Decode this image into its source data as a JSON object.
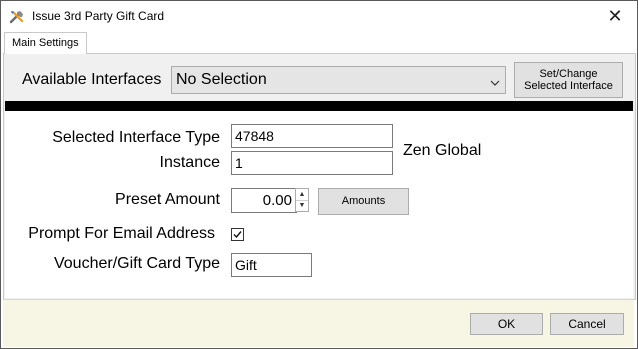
{
  "window": {
    "title": "Issue 3rd Party Gift Card"
  },
  "tabs": [
    {
      "label": "Main Settings"
    }
  ],
  "interfaces": {
    "label": "Available Interfaces",
    "selected": "No Selection",
    "set_button": "Set/Change Selected Interface"
  },
  "form": {
    "selected_interface_type_label": "Selected Interface Type",
    "selected_interface_type_value": "47848",
    "instance_label": "Instance",
    "instance_value": "1",
    "interface_name": "Zen Global",
    "preset_amount_label": "Preset Amount",
    "preset_amount_value": "0.00",
    "amounts_button": "Amounts",
    "prompt_email_label": "Prompt For Email Address",
    "prompt_email_checked": true,
    "voucher_type_label": "Voucher/Gift Card Type",
    "voucher_type_value": "Gift"
  },
  "footer": {
    "ok": "OK",
    "cancel": "Cancel"
  },
  "colors": {
    "footer_bg": "#f7f6e4",
    "bar": "#000000",
    "button_bg": "#e1e1e1"
  },
  "icons": {
    "app": "tools-icon",
    "close": "close-icon",
    "dropdown": "chevron-down-icon",
    "check": "checkmark-icon"
  }
}
